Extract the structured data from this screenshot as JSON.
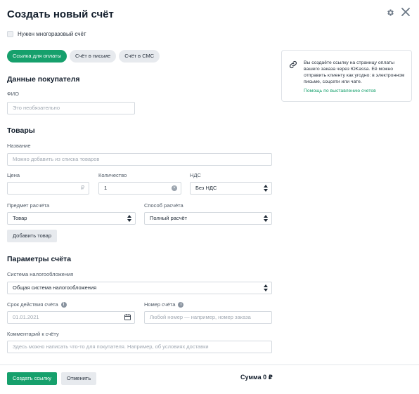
{
  "header": {
    "title": "Создать новый счёт",
    "settings_icon": "gear-icon",
    "close_icon": "close-icon"
  },
  "reusable": {
    "label": "Нужен многоразовый счёт",
    "checked": false
  },
  "tabs": [
    {
      "label": "Ссылка для оплаты",
      "active": true
    },
    {
      "label": "Счёт в письме",
      "active": false
    },
    {
      "label": "Счёт в СМС",
      "active": false
    }
  ],
  "info_card": {
    "icon": "link-icon",
    "text": "Вы создаёте ссылку на страницу оплаты вашего заказа через ЮKassa. Её можно отправить клиенту как угодно: в электронном письме, соцсети или чате.",
    "help_link": "Помощь по выставлению счетов"
  },
  "buyer": {
    "section_title": "Данные покупателя",
    "fio_label": "ФИО",
    "fio_placeholder": "Это необязательно"
  },
  "goods": {
    "section_title": "Товары",
    "name_label": "Название",
    "name_placeholder": "Можно добавить из списка товаров",
    "price_label": "Цена",
    "price_value": "",
    "price_currency": "₽",
    "quantity_label": "Количество",
    "quantity_value": "1",
    "vat_label": "НДС",
    "vat_value": "Без НДС",
    "subject_label": "Предмет расчёта",
    "subject_value": "Товар",
    "method_label": "Способ расчёта",
    "method_value": "Полный расчёт",
    "add_button": "Добавить товар"
  },
  "params": {
    "section_title": "Параметры счёта",
    "tax_label": "Система налогообложения",
    "tax_value": "Общая система налогообложения",
    "expiry_label": "Срок действия счёта",
    "expiry_value": "01.01.2021",
    "number_label": "Номер счёта",
    "number_placeholder": "Любой номер — например, номер заказа",
    "comment_label": "Комментарий к счёту",
    "comment_placeholder": "Здесь можно написать что-то для покупателя. Например, об условиях доставки"
  },
  "footer": {
    "create_button": "Создать ссылку",
    "cancel_button": "Отменить",
    "total": "Сумма 0 ₽"
  },
  "colors": {
    "accent": "#16a06c",
    "muted": "#e7eaee"
  }
}
